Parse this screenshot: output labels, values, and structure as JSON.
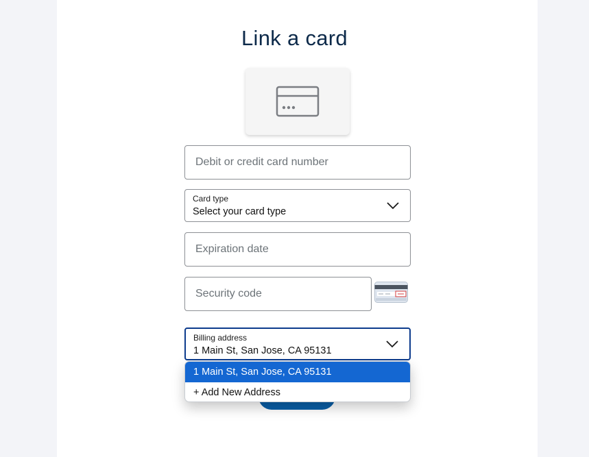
{
  "page": {
    "title": "Link a card"
  },
  "card_number": {
    "placeholder": "Debit or credit card number"
  },
  "card_type": {
    "label": "Card type",
    "value": "Select your card type"
  },
  "expiration": {
    "placeholder": "Expiration date"
  },
  "security_code": {
    "placeholder": "Security code"
  },
  "billing_address": {
    "label": "Billing address",
    "value": "1 Main St, San Jose, CA 95131"
  },
  "address_options": [
    {
      "label": "1 Main St, San Jose, CA 95131",
      "selected": true
    },
    {
      "label": "+ Add New Address",
      "selected": false
    }
  ],
  "colors": {
    "accent": "#1467d2",
    "button": "#0a5fa8",
    "active_border": "#0b3a8c"
  },
  "icons": [
    "credit-card-icon",
    "chevron-down-icon",
    "card-back-cvv-icon"
  ]
}
